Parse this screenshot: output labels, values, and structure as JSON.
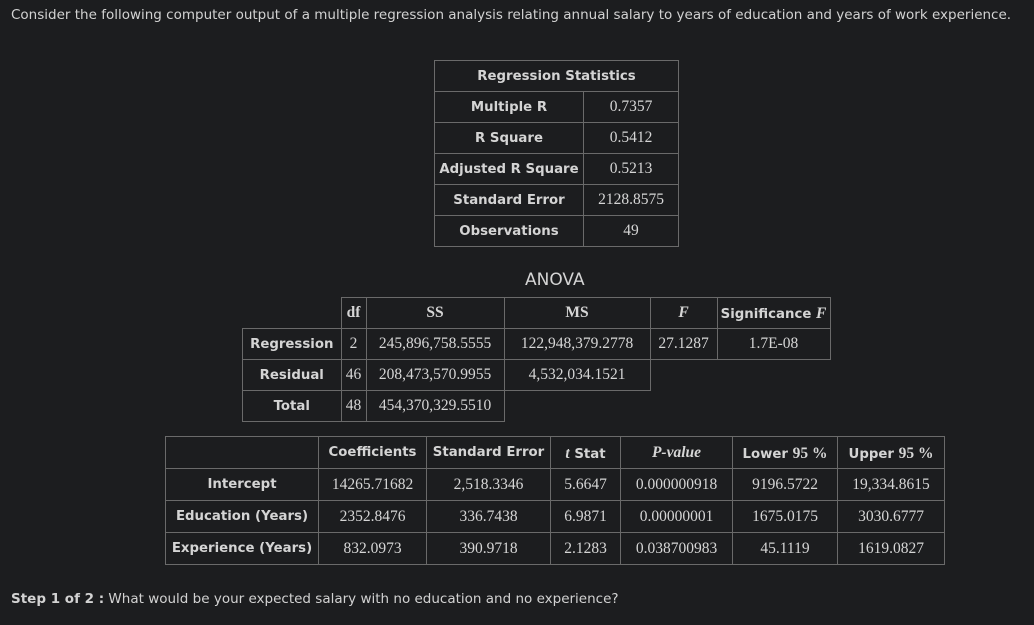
{
  "intro": "Consider the following computer output of a multiple regression analysis relating annual salary to years of education and years of work experience.",
  "regression_statistics": {
    "title": "Regression Statistics",
    "rows": [
      {
        "label": "Multiple R",
        "value": "0.7357"
      },
      {
        "label": "R Square",
        "value": "0.5412"
      },
      {
        "label": "Adjusted R Square",
        "value": "0.5213"
      },
      {
        "label": "Standard Error",
        "value": "2128.8575"
      },
      {
        "label": "Observations",
        "value": "49"
      }
    ]
  },
  "anova": {
    "title": "ANOVA",
    "headers": {
      "df": "df",
      "ss": "SS",
      "ms": "MS",
      "f": "F",
      "sig_prefix": "Significance ",
      "sig_f": "F"
    },
    "rows": [
      {
        "label": "Regression",
        "df": "2",
        "ss": "245,896,758.5555",
        "ms": "122,948,379.2778",
        "f": "27.1287",
        "sig": "1.7E-08"
      },
      {
        "label": "Residual",
        "df": "46",
        "ss": "208,473,570.9955",
        "ms": "4,532,034.1521"
      },
      {
        "label": "Total",
        "df": "48",
        "ss": "454,370,329.5510"
      }
    ]
  },
  "coefficients": {
    "headers": {
      "coef": "Coefficients",
      "se": "Standard Error",
      "t_italic": "t",
      "t_rest": " Stat",
      "p": "P-value",
      "lower_text": "Lower ",
      "lower_num": "95 %",
      "upper_text": "Upper ",
      "upper_num": "95 %"
    },
    "rows": [
      {
        "label": "Intercept",
        "coef": "14265.71682",
        "se": "2,518.3346",
        "t": "5.6647",
        "p": "0.000000918",
        "lower": "9196.5722",
        "upper": "19,334.8615"
      },
      {
        "label": "Education (Years)",
        "coef": "2352.8476",
        "se": "336.7438",
        "t": "6.9871",
        "p": "0.00000001",
        "lower": "1675.0175",
        "upper": "3030.6777"
      },
      {
        "label": "Experience (Years)",
        "coef": "832.0973",
        "se": "390.9718",
        "t": "2.1283",
        "p": "0.038700983",
        "lower": "45.1119",
        "upper": "1619.0827"
      }
    ]
  },
  "step": {
    "label": "Step 1 of 2 :",
    "question": " What would be your expected salary with no education and no experience?"
  }
}
